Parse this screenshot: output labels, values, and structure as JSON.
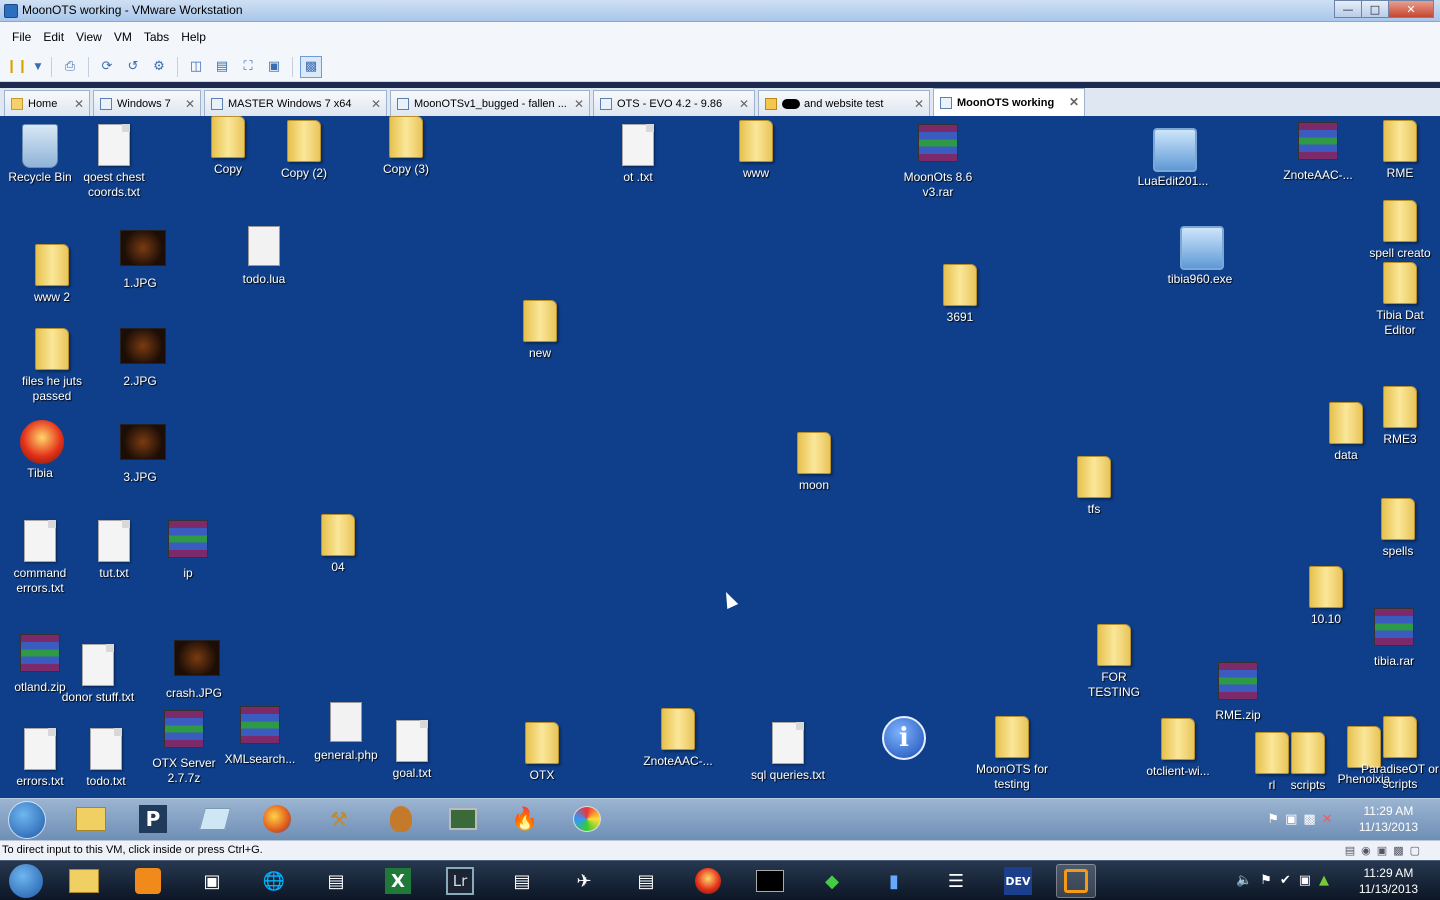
{
  "window": {
    "title": "MoonOTS working - VMware Workstation"
  },
  "menu": [
    "File",
    "Edit",
    "View",
    "VM",
    "Tabs",
    "Help"
  ],
  "tabs": [
    {
      "label": "Home",
      "active": false
    },
    {
      "label": "Windows 7",
      "active": false
    },
    {
      "label": "MASTER Windows 7 x64",
      "active": false
    },
    {
      "label": "MoonOTSv1_bugged - fallen ...",
      "active": false
    },
    {
      "label": "OTS - EVO 4.2 - 9.86",
      "active": false
    },
    {
      "label": "and website test",
      "active": false
    },
    {
      "label": "MoonOTS working",
      "active": true
    }
  ],
  "desktop": {
    "icons": [
      {
        "label": "Recycle Bin",
        "type": "bin"
      },
      {
        "label": "qoest chest coords.txt",
        "type": "doc"
      },
      {
        "label": "Copy",
        "type": "folder"
      },
      {
        "label": "Copy (2)",
        "type": "folder"
      },
      {
        "label": "Copy (3)",
        "type": "folder"
      },
      {
        "label": "ot .txt",
        "type": "doc"
      },
      {
        "label": "www",
        "type": "folder"
      },
      {
        "label": "MoonOts 8.6 v3.rar",
        "type": "rar"
      },
      {
        "label": "LuaEdit201...",
        "type": "exe"
      },
      {
        "label": "ZnoteAAC-...",
        "type": "rar"
      },
      {
        "label": "RME",
        "type": "folder"
      },
      {
        "label": "www 2",
        "type": "folder"
      },
      {
        "label": "1.JPG",
        "type": "photo"
      },
      {
        "label": "todo.lua",
        "type": "lua"
      },
      {
        "label": "spell creato",
        "type": "folder"
      },
      {
        "label": "tibia960.exe",
        "type": "exe"
      },
      {
        "label": "3691",
        "type": "folder"
      },
      {
        "label": "new",
        "type": "folder"
      },
      {
        "label": "Tibia Dat Editor",
        "type": "folder"
      },
      {
        "label": "files he juts passed",
        "type": "folder"
      },
      {
        "label": "2.JPG",
        "type": "photo"
      },
      {
        "label": "Tibia",
        "type": "tibia"
      },
      {
        "label": "3.JPG",
        "type": "photo"
      },
      {
        "label": "moon",
        "type": "folder"
      },
      {
        "label": "data",
        "type": "folder"
      },
      {
        "label": "RME3",
        "type": "folder"
      },
      {
        "label": "tfs",
        "type": "folder"
      },
      {
        "label": "command errors.txt",
        "type": "doc"
      },
      {
        "label": "tut.txt",
        "type": "doc"
      },
      {
        "label": "ip",
        "type": "rar"
      },
      {
        "label": "04",
        "type": "folder"
      },
      {
        "label": "spells",
        "type": "folder"
      },
      {
        "label": "10.10",
        "type": "folder"
      },
      {
        "label": "otland.zip",
        "type": "rar"
      },
      {
        "label": "donor stuff.txt",
        "type": "doc"
      },
      {
        "label": "crash.JPG",
        "type": "photo"
      },
      {
        "label": "tibia.rar",
        "type": "rar"
      },
      {
        "label": "FOR TESTING",
        "type": "folder"
      },
      {
        "label": "RME.zip",
        "type": "rar"
      },
      {
        "label": "errors.txt",
        "type": "doc"
      },
      {
        "label": "todo.txt",
        "type": "doc"
      },
      {
        "label": "OTX Server 2.7.7z",
        "type": "rar"
      },
      {
        "label": "XMLsearch...",
        "type": "rar"
      },
      {
        "label": "general.php",
        "type": "lua"
      },
      {
        "label": "goal.txt",
        "type": "doc"
      },
      {
        "label": "OTX",
        "type": "folder"
      },
      {
        "label": "ZnoteAAC-...",
        "type": "folder"
      },
      {
        "label": "sql queries.txt",
        "type": "doc"
      },
      {
        "label": "",
        "type": "info"
      },
      {
        "label": "MoonOTS for testing",
        "type": "folder"
      },
      {
        "label": "otclient-wi...",
        "type": "folder"
      },
      {
        "label": "rl",
        "type": "folder"
      },
      {
        "label": "scripts",
        "type": "folder"
      },
      {
        "label": "Phenoixia",
        "type": "folder"
      },
      {
        "label": "ParadiseOT or scripts",
        "type": "folder"
      }
    ]
  },
  "vm_clock": {
    "time": "11:29 AM",
    "date": "11/13/2013"
  },
  "status": {
    "text": "To direct input to this VM, click inside or press Ctrl+G."
  },
  "host_clock": {
    "time": "11:29 AM",
    "date": "11/13/2013"
  }
}
